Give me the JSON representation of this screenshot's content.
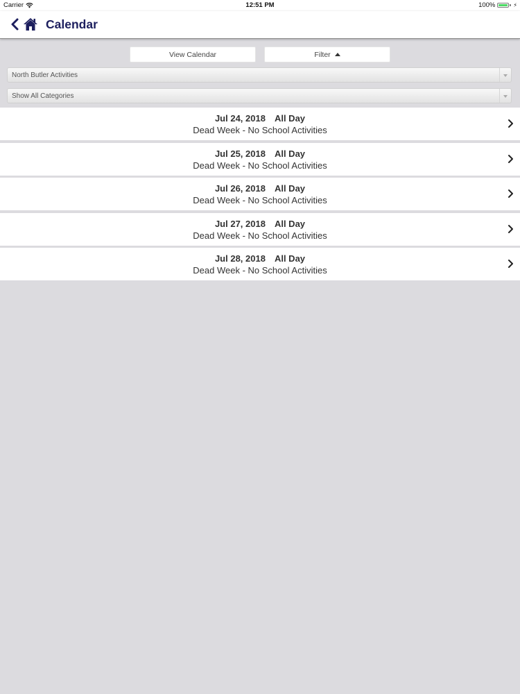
{
  "status_bar": {
    "carrier": "Carrier",
    "time": "12:51 PM",
    "battery_text": "100%",
    "battery_level": 1.0
  },
  "nav": {
    "title": "Calendar",
    "back_icon": "chevron-left-icon",
    "home_icon": "home-icon",
    "accent_color": "#1d1f5e"
  },
  "filters": {
    "view_calendar_label": "View Calendar",
    "filter_label": "Filter",
    "organization_value": "North Butler Activities",
    "category_value": "Show All Categories"
  },
  "events": [
    {
      "date": "Jul 24, 2018",
      "time": "All Day",
      "title": "Dead Week - No School Activities"
    },
    {
      "date": "Jul 25, 2018",
      "time": "All Day",
      "title": "Dead Week - No School Activities"
    },
    {
      "date": "Jul 26, 2018",
      "time": "All Day",
      "title": "Dead Week - No School Activities"
    },
    {
      "date": "Jul 27, 2018",
      "time": "All Day",
      "title": "Dead Week - No School Activities"
    },
    {
      "date": "Jul 28, 2018",
      "time": "All Day",
      "title": "Dead Week - No School Activities"
    }
  ]
}
